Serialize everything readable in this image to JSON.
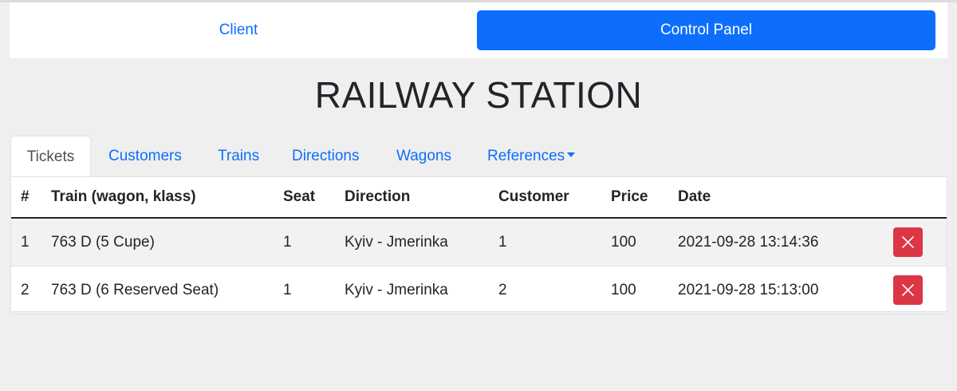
{
  "nav": {
    "client_label": "Client",
    "control_panel_label": "Control Panel"
  },
  "page": {
    "title": "RAILWAY STATION"
  },
  "tabs": [
    {
      "label": "Tickets",
      "active": true
    },
    {
      "label": "Customers",
      "active": false
    },
    {
      "label": "Trains",
      "active": false
    },
    {
      "label": "Directions",
      "active": false
    },
    {
      "label": "Wagons",
      "active": false
    },
    {
      "label": "References",
      "active": false,
      "dropdown": true
    }
  ],
  "table": {
    "columns": [
      "#",
      "Train (wagon, klass)",
      "Seat",
      "Direction",
      "Customer",
      "Price",
      "Date"
    ],
    "rows": [
      {
        "num": "1",
        "train": "763 D (5 Cupe)",
        "seat": "1",
        "direction": "Kyiv - Jmerinka",
        "customer": "1",
        "price": "100",
        "date": "2021-09-28 13:14:36"
      },
      {
        "num": "2",
        "train": "763 D (6 Reserved Seat)",
        "seat": "1",
        "direction": "Kyiv - Jmerinka",
        "customer": "2",
        "price": "100",
        "date": "2021-09-28 15:13:00"
      }
    ]
  },
  "icons": {
    "delete": "close-icon"
  },
  "colors": {
    "primary": "#0d6efd",
    "danger": "#dc3545",
    "background": "#efefef"
  }
}
